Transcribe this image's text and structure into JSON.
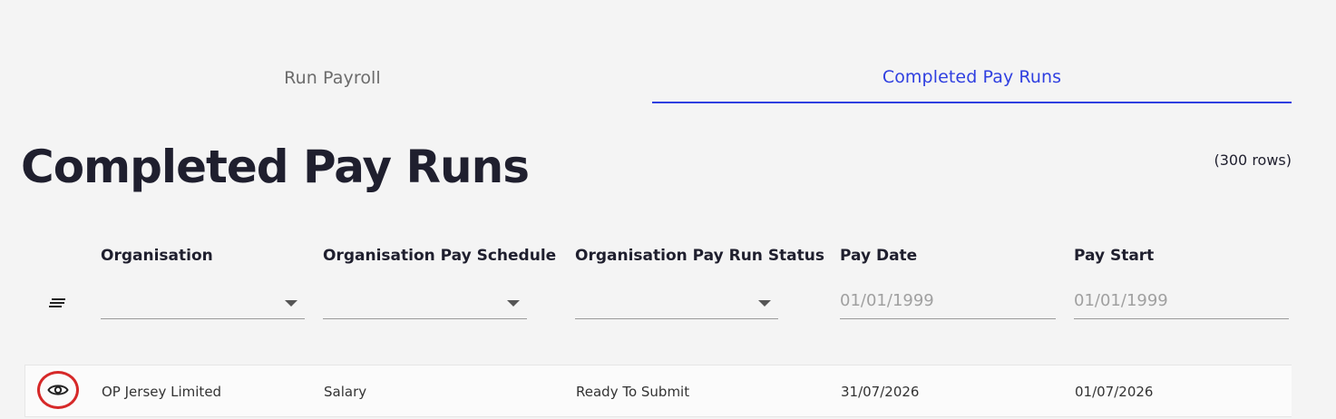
{
  "tabs": [
    {
      "label": "Run Payroll",
      "active": false
    },
    {
      "label": "Completed Pay Runs",
      "active": true
    }
  ],
  "page": {
    "title": "Completed Pay Runs",
    "row_count": "(300 rows)"
  },
  "columns": [
    {
      "label": "Organisation",
      "filter_type": "select",
      "value": ""
    },
    {
      "label": "Organisation Pay Schedule",
      "filter_type": "select",
      "value": ""
    },
    {
      "label": "Organisation Pay Run Status",
      "filter_type": "select",
      "value": ""
    },
    {
      "label": "Pay Date",
      "filter_type": "date",
      "placeholder": "01/01/1999"
    },
    {
      "label": "Pay Start",
      "filter_type": "date",
      "placeholder": "01/01/1999"
    }
  ],
  "rows": [
    {
      "organisation": "OP Jersey Limited",
      "pay_schedule": "Salary",
      "status": "Ready To Submit",
      "pay_date": "31/07/2026",
      "pay_start": "01/07/2026"
    }
  ],
  "icons": {
    "sort": "sort-lines-icon",
    "view": "eye-icon",
    "dropdown": "caret-down-icon"
  },
  "colors": {
    "accent": "#2f3fe0",
    "highlight_ring": "#d62828"
  }
}
